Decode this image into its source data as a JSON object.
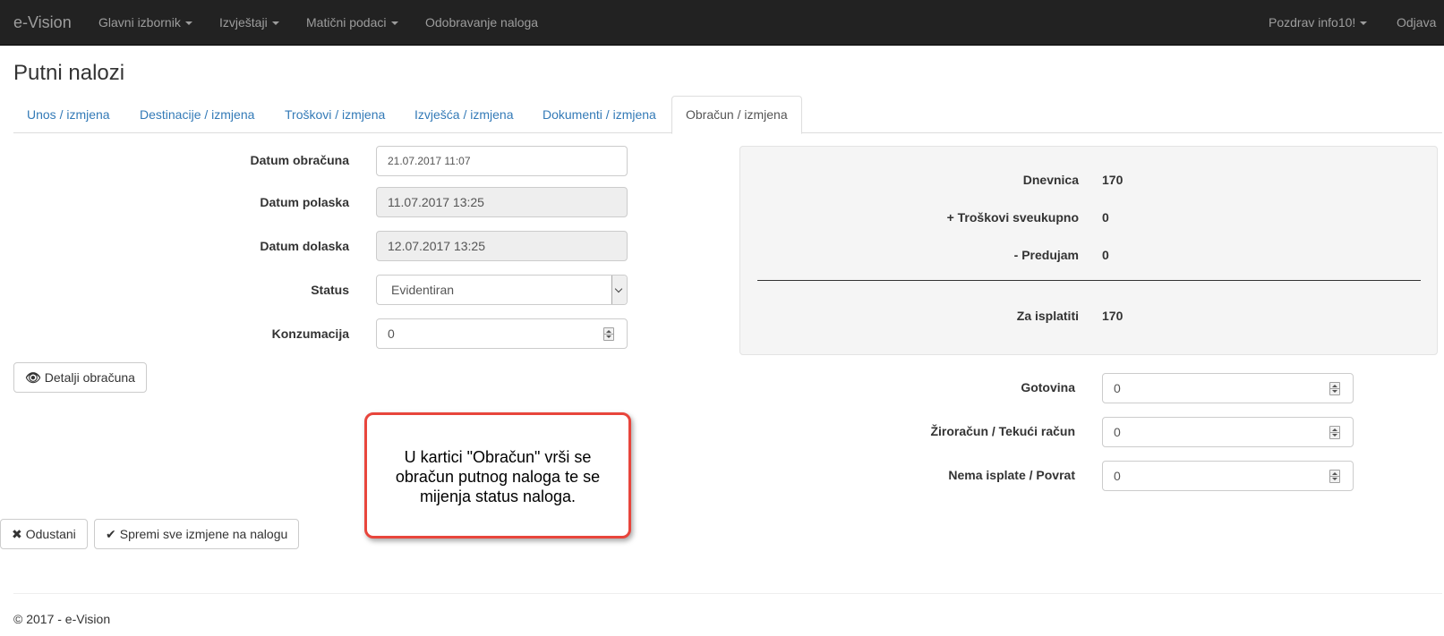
{
  "navbar": {
    "brand": "e-Vision",
    "menu": [
      "Glavni izbornik",
      "Izvještaji",
      "Matični podaci",
      "Odobravanje naloga"
    ],
    "greeting": "Pozdrav info10!",
    "logout": "Odjava"
  },
  "page": {
    "title": "Putni nalozi"
  },
  "tabs": [
    "Unos / izmjena",
    "Destinacije / izmjena",
    "Troškovi / izmjena",
    "Izvješća / izmjena",
    "Dokumenti / izmjena",
    "Obračun / izmjena"
  ],
  "form": {
    "datum_obracuna": {
      "label": "Datum obračuna",
      "value": "21.07.2017  11:07"
    },
    "datum_polaska": {
      "label": "Datum polaska",
      "value": "11.07.2017 13:25"
    },
    "datum_dolaska": {
      "label": "Datum dolaska",
      "value": "12.07.2017 13:25"
    },
    "status": {
      "label": "Status",
      "value": "Evidentiran"
    },
    "konzumacija": {
      "label": "Konzumacija",
      "value": "0"
    }
  },
  "buttons": {
    "details": "Detalji obračuna",
    "cancel": "Odustani",
    "save": "Spremi sve izmjene na nalogu"
  },
  "summary": {
    "dnevnica": {
      "label": "Dnevnica",
      "value": "170"
    },
    "troskovi": {
      "label": "+ Troškovi sveukupno",
      "value": "0"
    },
    "predujam": {
      "label": "- Predujam",
      "value": "0"
    },
    "za_isplatiti": {
      "label": "Za isplatiti",
      "value": "170"
    }
  },
  "payment": {
    "gotovina": {
      "label": "Gotovina",
      "value": "0"
    },
    "ziroracun": {
      "label": "Žiroračun / Tekući račun",
      "value": "0"
    },
    "nema_isplate": {
      "label": "Nema isplate / Povrat",
      "value": "0"
    }
  },
  "callout": {
    "text": "U kartici \"Obračun\" vrši se obračun putnog naloga te se mijenja status naloga."
  },
  "footer": {
    "text": "© 2017 - e-Vision"
  }
}
